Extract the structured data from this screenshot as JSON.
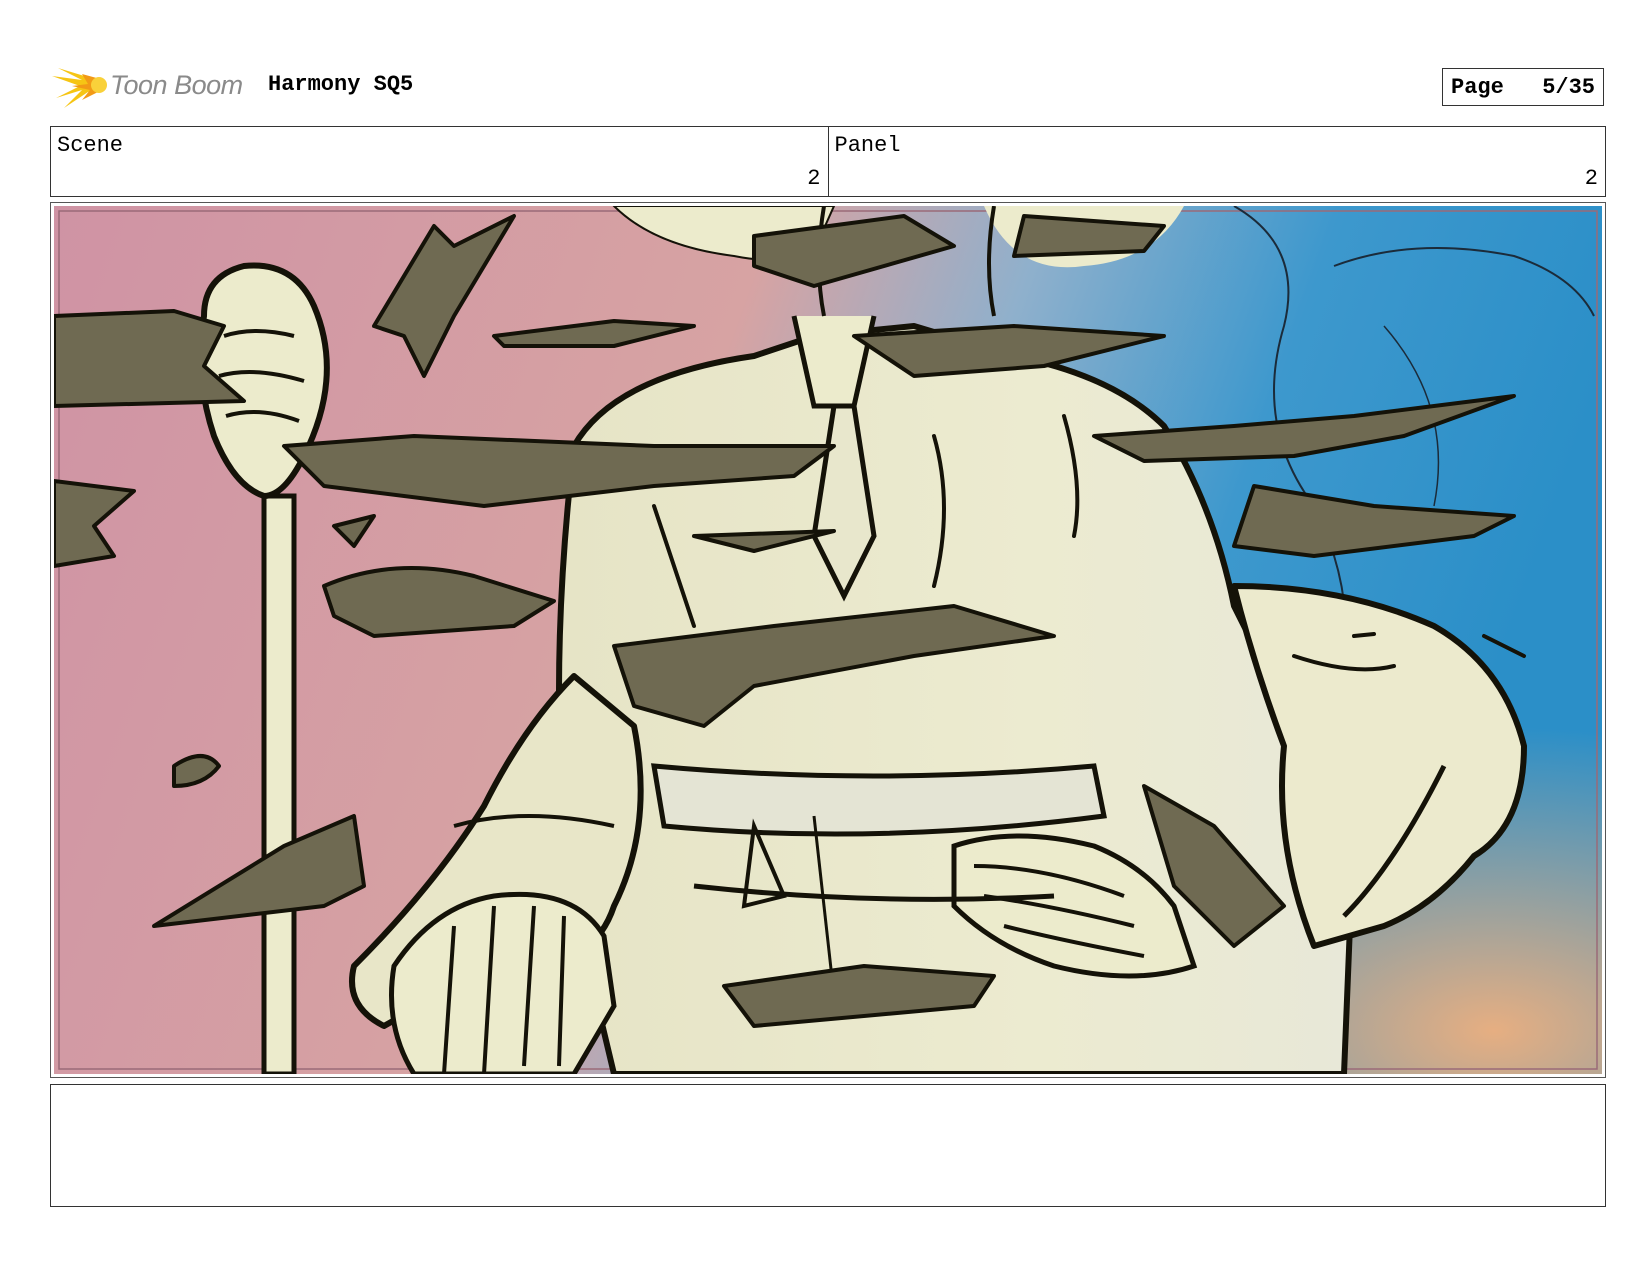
{
  "header": {
    "brand": "Toon Boom",
    "project_title": "Harmony SQ5",
    "page_label": "Page",
    "page_number": "5/35"
  },
  "info": {
    "scene_label": "Scene",
    "scene_value": "2",
    "panel_label": "Panel",
    "panel_value": "2"
  },
  "colors": {
    "background_pink": "#d49aa6",
    "background_blue": "#2d93c9",
    "figure_cream": "#ecebcc",
    "smear_olive": "#6f6a52",
    "ink": "#141208",
    "logo_yellow": "#f6c514"
  },
  "notes": ""
}
